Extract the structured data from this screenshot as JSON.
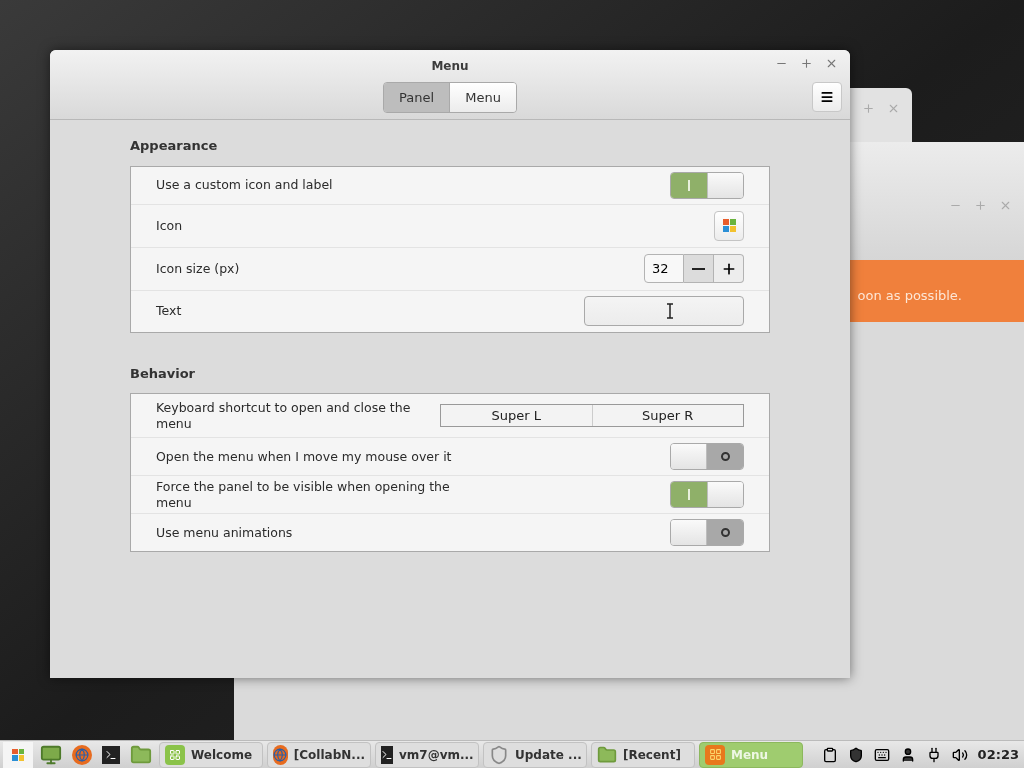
{
  "window": {
    "title": "Menu",
    "tabs": [
      {
        "label": "Panel",
        "selected": true
      },
      {
        "label": "Menu",
        "selected": false
      }
    ]
  },
  "sections": [
    {
      "title": "Appearance",
      "rows": [
        {
          "kind": "switch",
          "label": "Use a custom icon and label",
          "on": true
        },
        {
          "kind": "icon",
          "label": "Icon"
        },
        {
          "kind": "spin",
          "label": "Icon size (px)",
          "value": "32"
        },
        {
          "kind": "entry",
          "label": "Text"
        }
      ]
    },
    {
      "title": "Behavior",
      "rows": [
        {
          "kind": "keys",
          "label": "Keyboard shortcut to open and close the menu",
          "keys": [
            "Super L",
            "Super R"
          ]
        },
        {
          "kind": "switch",
          "label": "Open the menu when I move my mouse over it",
          "on": false
        },
        {
          "kind": "switch",
          "label": "Force the panel to be visible when opening the menu",
          "on": true
        },
        {
          "kind": "switch",
          "label": "Use menu animations",
          "on": false
        }
      ]
    }
  ],
  "background_window": {
    "banner": "oon as possible."
  },
  "taskbar": {
    "windows": [
      {
        "kind": "mint",
        "label": "Welcome",
        "selected": false
      },
      {
        "kind": "browser",
        "label": "[CollabN...",
        "selected": false
      },
      {
        "kind": "terminal",
        "label": "vm7@vm...",
        "selected": false
      },
      {
        "kind": "shield",
        "label": "Update ...",
        "selected": false
      },
      {
        "kind": "folder",
        "label": "[Recent]",
        "selected": false
      },
      {
        "kind": "menu",
        "label": "Menu",
        "selected": true
      }
    ],
    "clock": "02:23"
  }
}
